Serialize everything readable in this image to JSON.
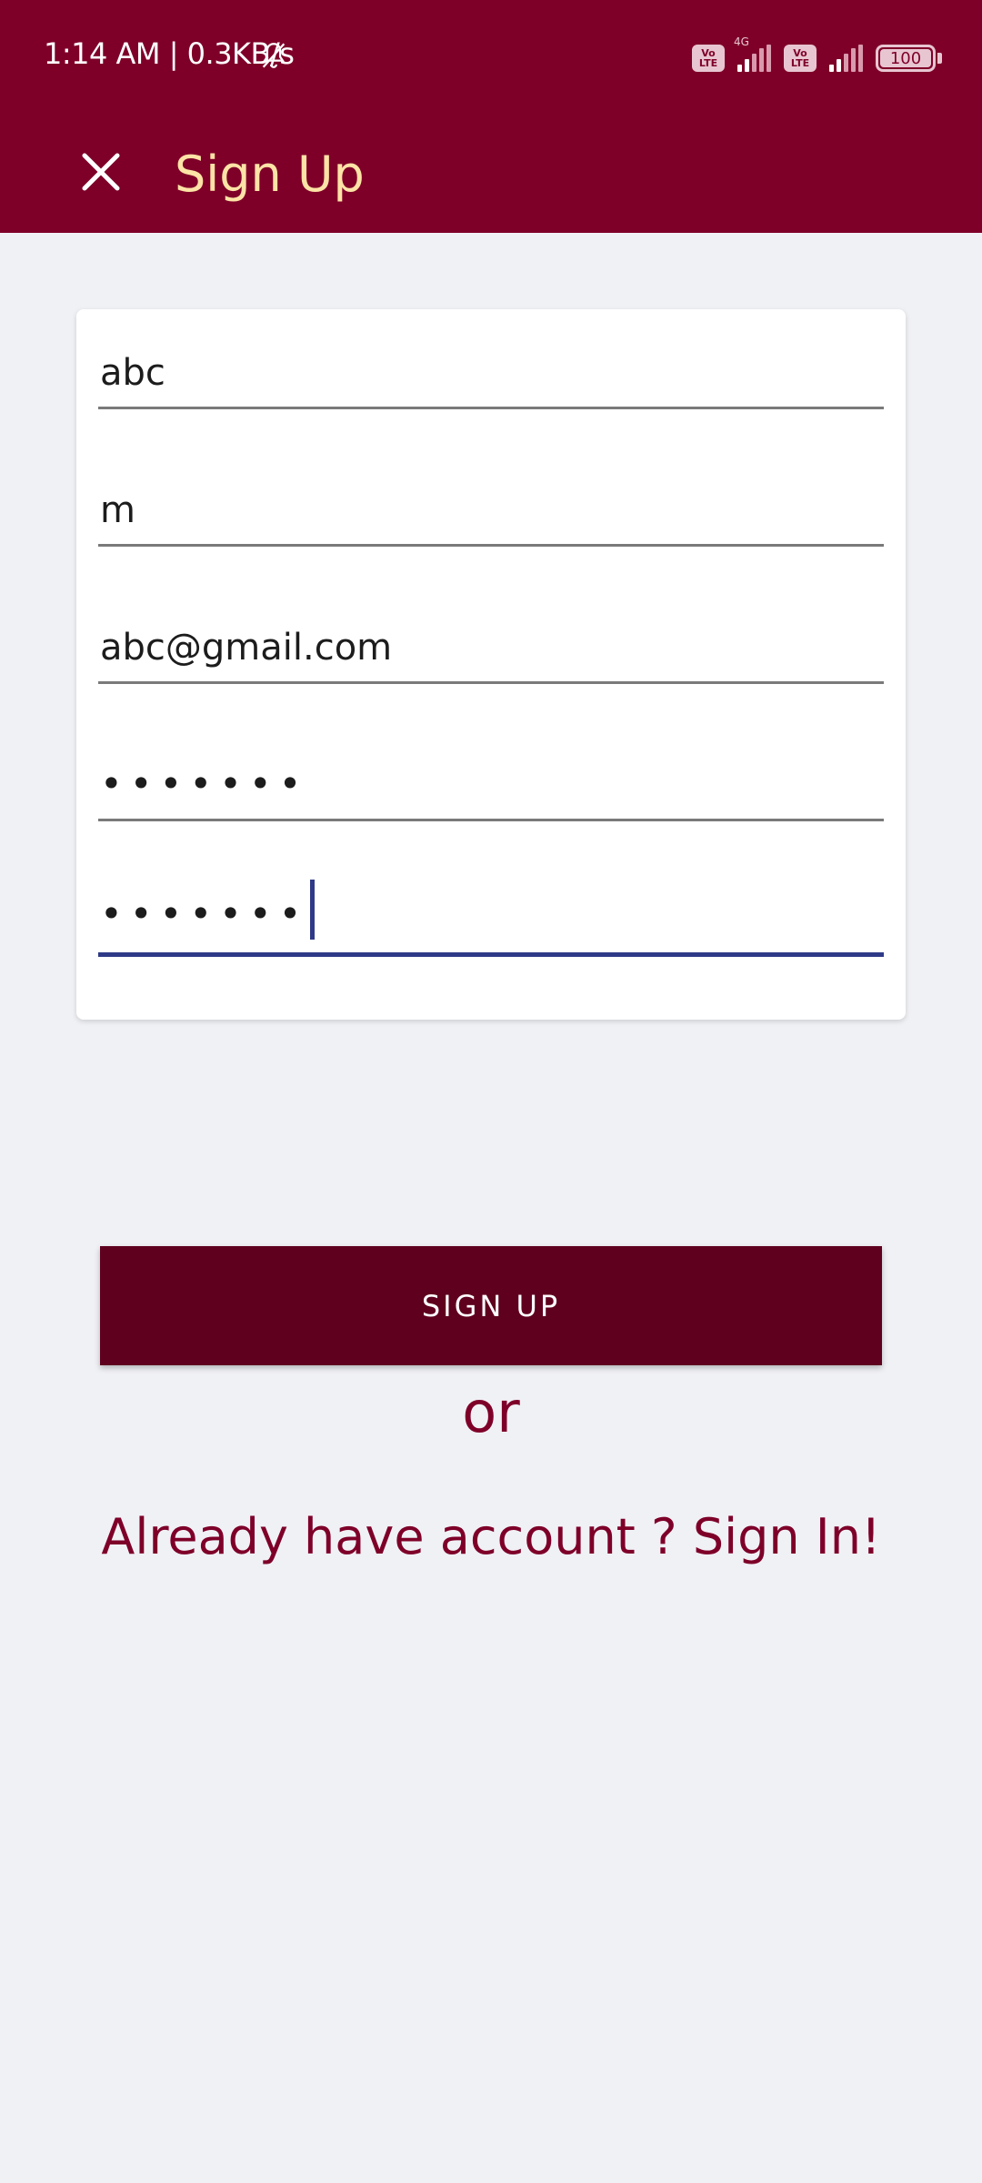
{
  "status_bar": {
    "time_speed": "1:14 AM | 0.3KB/s",
    "network_type": "4G",
    "volte_label": "Vo LTE",
    "battery_level": "100"
  },
  "app_bar": {
    "title": "Sign Up",
    "close_icon": "close-icon"
  },
  "form": {
    "fields": [
      {
        "value": "abc"
      },
      {
        "value": "m"
      },
      {
        "value": "abc@gmail.com"
      },
      {
        "value": "•••••••"
      },
      {
        "value": "•••••••"
      }
    ]
  },
  "actions": {
    "signup_label": "SIGN UP",
    "or_text": "or",
    "signin_link": "Already have account ? Sign In!"
  },
  "colors": {
    "brand": "#7e0029",
    "button": "#5e001e",
    "title": "#fde3a6",
    "focus": "#2e3a87",
    "background": "#f0f1f5"
  }
}
